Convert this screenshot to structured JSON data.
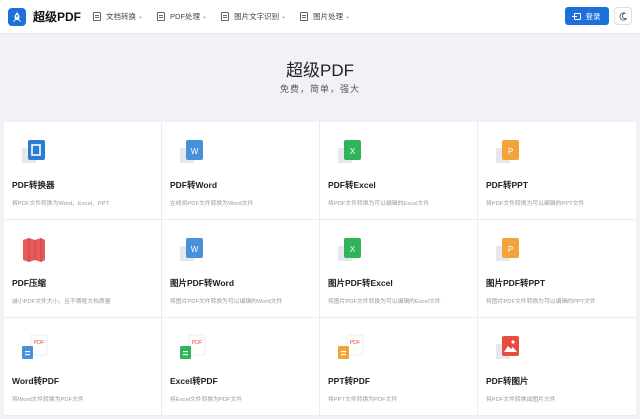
{
  "header": {
    "brand": "超级PDF",
    "nav": [
      {
        "label": "文档转换",
        "icon": "document-convert-icon"
      },
      {
        "label": "PDF处理",
        "icon": "pdf-process-icon"
      },
      {
        "label": "图片文字识别",
        "icon": "ocr-icon"
      },
      {
        "label": "图片处理",
        "icon": "image-process-icon"
      }
    ],
    "login_label": "登录",
    "theme_icon": "moon-icon"
  },
  "hero": {
    "title": "超级PDF",
    "subtitle": "免费，简单，强大"
  },
  "colors": {
    "accent": "#1e6fd9",
    "office": "#2b7cd3",
    "word": "#4a90d9",
    "excel": "#2fb45a",
    "ppt": "#f2a33a",
    "compress": "#e85a5a",
    "pdf_badge": "#e84c3d"
  },
  "tools": [
    {
      "title": "PDF转换器",
      "desc": "将PDF文件转换为Word、Excel、PPT",
      "icon": "office-icon"
    },
    {
      "title": "PDF转Word",
      "desc": "在线将PDF文件转换为Word文件",
      "icon": "word-icon"
    },
    {
      "title": "PDF转Excel",
      "desc": "将PDF文件转换为可以编辑的Excel文件",
      "icon": "excel-icon"
    },
    {
      "title": "PDF转PPT",
      "desc": "将PDF文件转换为可以编辑的PPT文件",
      "icon": "ppt-icon"
    },
    {
      "title": "PDF压缩",
      "desc": "减小PDF文件大小，且不牺牲文档质量",
      "icon": "compress-icon"
    },
    {
      "title": "图片PDF转Word",
      "desc": "将图片PDF文件转换为可以编辑的Word文件",
      "icon": "word-icon"
    },
    {
      "title": "图片PDF转Excel",
      "desc": "将图片PDF文件转换为可以编辑的Excel文件",
      "icon": "excel-icon"
    },
    {
      "title": "图片PDF转PPT",
      "desc": "将图片PDF文件转换为可以编辑的PPT文件",
      "icon": "ppt-icon"
    },
    {
      "title": "Word转PDF",
      "desc": "将Word文件转换为PDF文件",
      "icon": "word-to-pdf-icon"
    },
    {
      "title": "Excel转PDF",
      "desc": "将Excel文件转换为PDF文件",
      "icon": "excel-to-pdf-icon"
    },
    {
      "title": "PPT转PDF",
      "desc": "将PPT文件转换为PDF文件",
      "icon": "ppt-to-pdf-icon"
    },
    {
      "title": "PDF转图片",
      "desc": "将PDF文件转换成图片文件",
      "icon": "image-icon"
    }
  ]
}
